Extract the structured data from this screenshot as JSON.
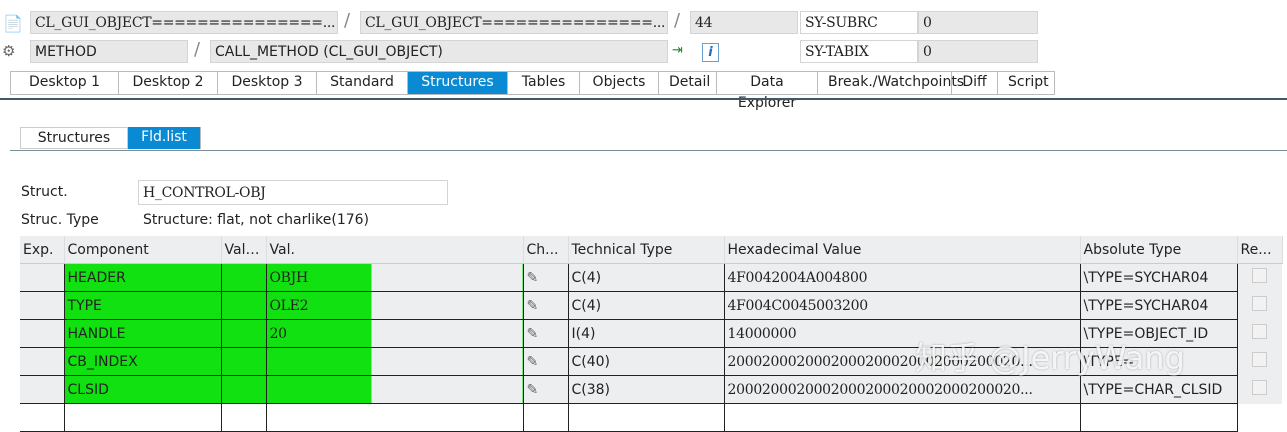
{
  "header": {
    "program": "CL_GUI_OBJECT===============...",
    "include": "CL_GUI_OBJECT===============...",
    "line": "44",
    "event_type": "METHOD",
    "event": "CALL_METHOD (CL_GUI_OBJECT)",
    "sy_subrc_label": "SY-SUBRC",
    "sy_subrc": "0",
    "sy_tabix_label": "SY-TABIX",
    "sy_tabix": "0"
  },
  "tabs": [
    "Desktop 1",
    "Desktop 2",
    "Desktop 3",
    "Standard",
    "Structures",
    "Tables",
    "Objects",
    "Detail",
    "Data Explorer",
    "Break./Watchpoints",
    "Diff",
    "Script"
  ],
  "active_tab": "Structures",
  "subtabs": [
    "Structures",
    "Fld.list"
  ],
  "active_subtab": "Fld.list",
  "struct": {
    "label": "Struct.",
    "value": "H_CONTROL-OBJ",
    "type_label": "Struc. Type",
    "type_value": "Structure: flat, not charlike(176)"
  },
  "grid": {
    "columns": [
      "Exp.",
      "Component",
      "Val....",
      "Val.",
      "Ch...",
      "Technical Type",
      "Hexadecimal Value",
      "Absolute Type",
      "Re..."
    ],
    "rows": [
      {
        "component": "HEADER",
        "val": "OBJH",
        "tech": "C(4)",
        "hex": "4F0042004A004800",
        "abs": "\\TYPE=SYCHAR04"
      },
      {
        "component": "TYPE",
        "val": "OLE2",
        "tech": "C(4)",
        "hex": "4F004C0045003200",
        "abs": "\\TYPE=SYCHAR04"
      },
      {
        "component": "HANDLE",
        "val": "20",
        "tech": "I(4)",
        "hex": "14000000",
        "abs": "\\TYPE=OBJECT_ID"
      },
      {
        "component": "CB_INDEX",
        "val": "",
        "tech": "C(40)",
        "hex": "2000200020002000200020002000200020...",
        "abs": "\\TYPE="
      },
      {
        "component": "CLSID",
        "val": "",
        "tech": "C(38)",
        "hex": "2000200020002000200020002000200020...",
        "abs": "\\TYPE=CHAR_CLSID"
      }
    ]
  },
  "watermark": "知乎 @JerryWang",
  "colors": {
    "active_tab": "#0a8ad2",
    "highlight": "#11e011"
  }
}
